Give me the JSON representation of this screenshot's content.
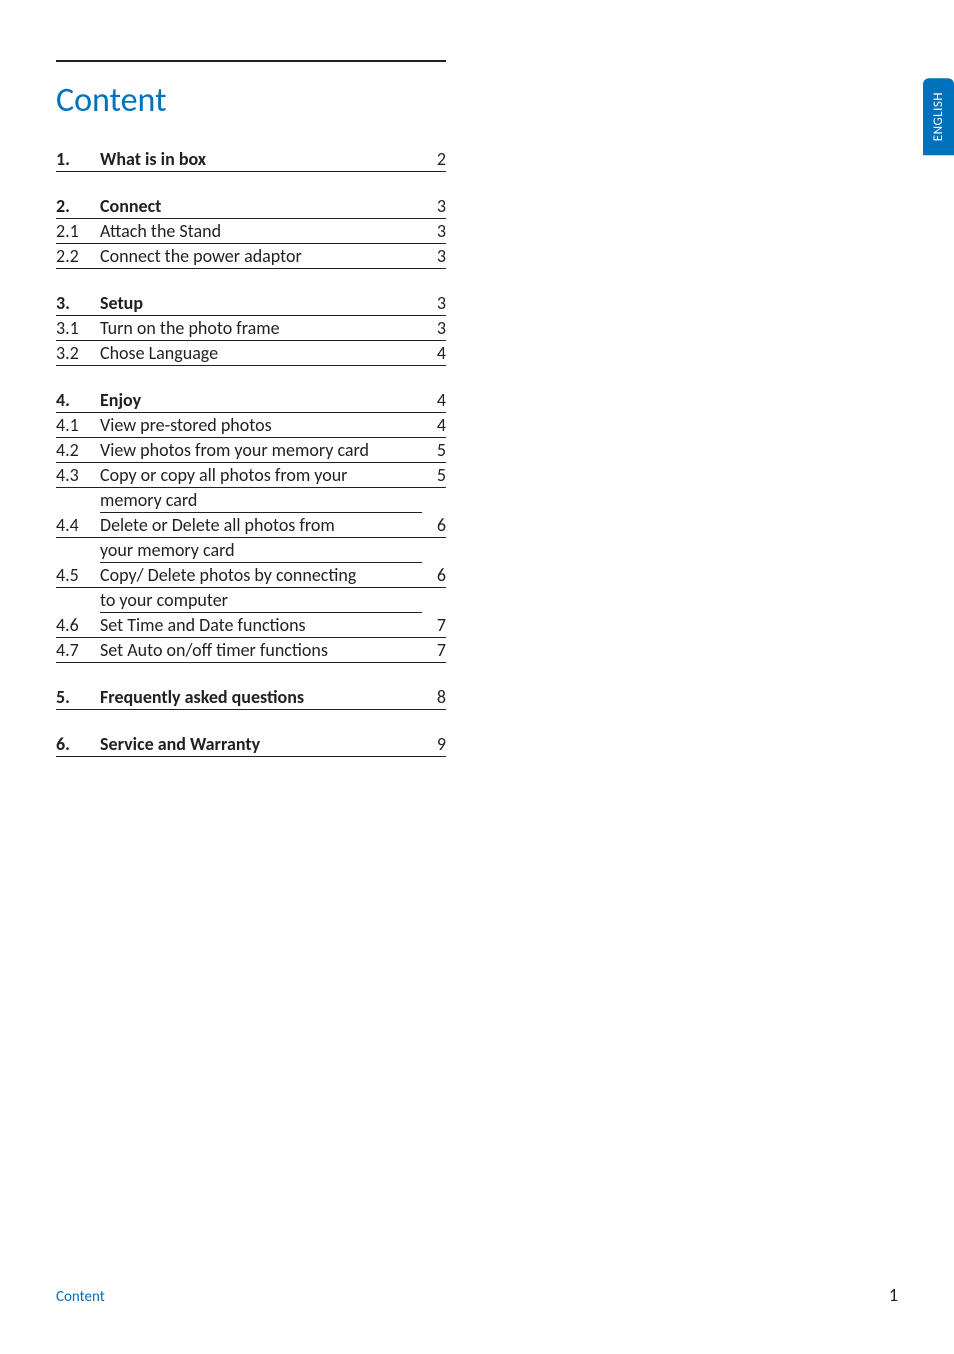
{
  "heading": "Content",
  "langTab": "ENGLISH",
  "footerLabel": "Content",
  "pageNumber": "1",
  "sections": [
    {
      "head": {
        "num": "1.",
        "title": "What is in box",
        "page": "2"
      },
      "items": []
    },
    {
      "head": {
        "num": "2.",
        "title": "Connect",
        "page": "3"
      },
      "items": [
        {
          "num": "2.1",
          "title": "Attach the Stand",
          "page": "3"
        },
        {
          "num": "2.2",
          "title": "Connect the power adaptor",
          "page": "3"
        }
      ]
    },
    {
      "head": {
        "num": "3.",
        "title": "Setup",
        "page": "3"
      },
      "items": [
        {
          "num": "3.1",
          "title": "Turn on the photo frame",
          "page": "3"
        },
        {
          "num": "3.2",
          "title": "Chose Language",
          "page": "4"
        }
      ]
    },
    {
      "head": {
        "num": "4.",
        "title": "Enjoy",
        "page": "4"
      },
      "items": [
        {
          "num": "4.1",
          "title": "View pre-stored photos",
          "page": "4"
        },
        {
          "num": "4.2",
          "title": "View photos from your memory card",
          "page": "5"
        },
        {
          "num": "4.3",
          "title": "Copy or copy all photos from your",
          "page": "5",
          "cont": "memory card"
        },
        {
          "num": "4.4",
          "title": "Delete or Delete all photos from",
          "page": "6",
          "cont": "your memory card"
        },
        {
          "num": "4.5",
          "title": "Copy/ Delete photos by connecting",
          "page": "6",
          "cont": "to your computer"
        },
        {
          "num": "4.6",
          "title": "Set Time and Date functions",
          "page": "7"
        },
        {
          "num": "4.7",
          "title": "Set Auto on/off timer functions",
          "page": "7"
        }
      ]
    },
    {
      "head": {
        "num": "5.",
        "title": "Frequently asked questions",
        "page": "8"
      },
      "items": []
    },
    {
      "head": {
        "num": "6.",
        "title": "Service and Warranty",
        "page": "9"
      },
      "items": []
    }
  ]
}
